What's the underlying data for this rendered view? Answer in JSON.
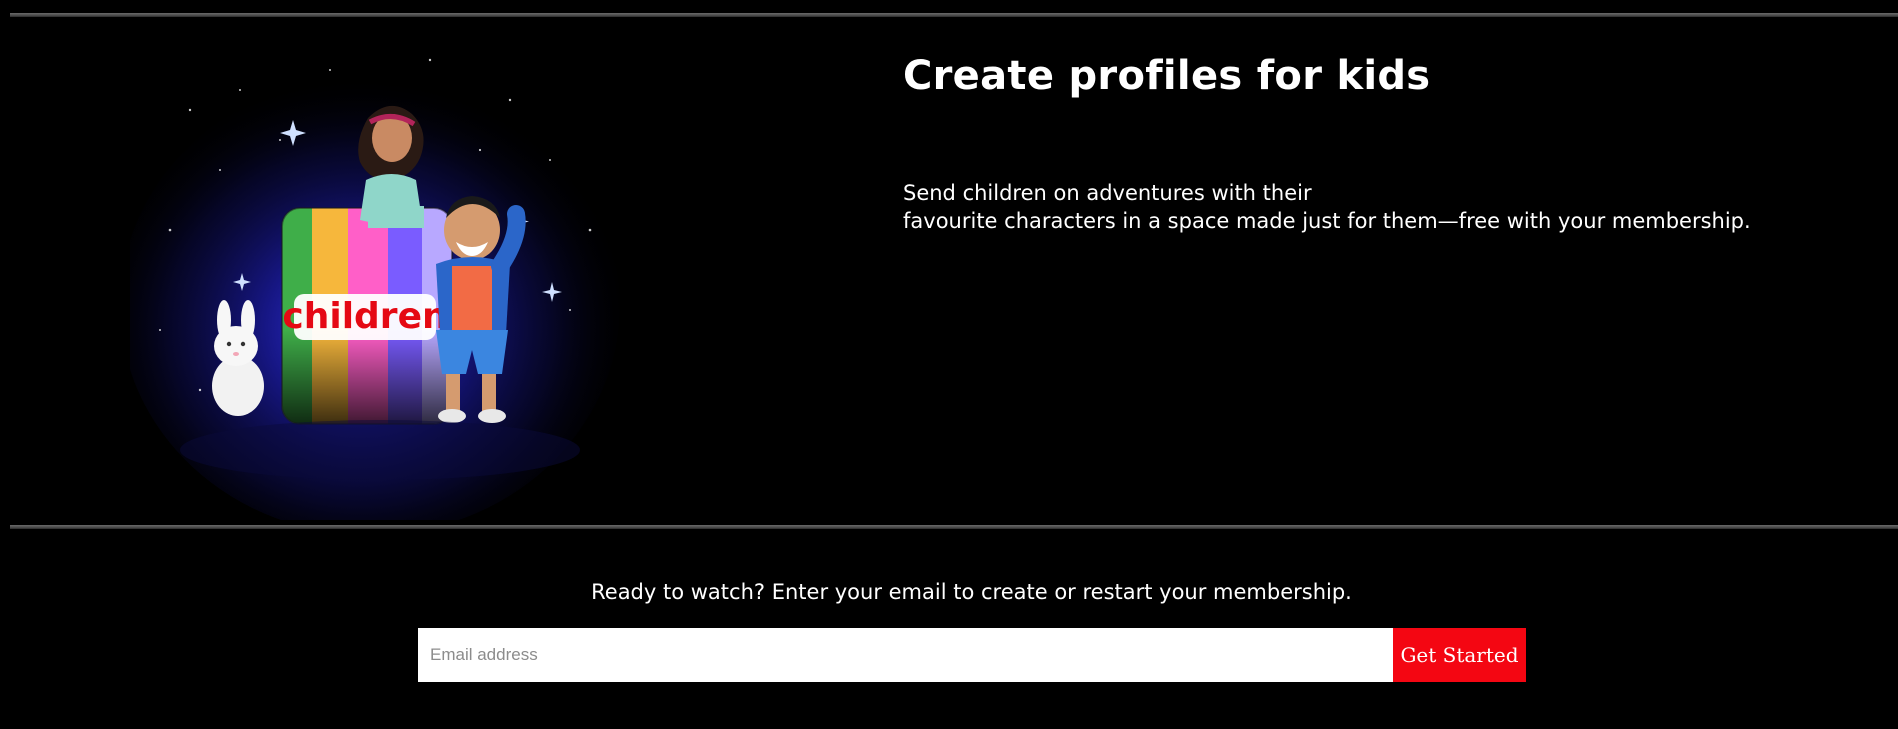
{
  "feature": {
    "title": "Create profiles for kids",
    "description_line1": "Send children on adventures with their",
    "description_line2": "favourite characters in a space made just for them—free with your membership.",
    "image_label": "children",
    "image_subject": "kids-profile-illustration"
  },
  "signup": {
    "prompt": "Ready to watch? Enter your email to create or restart your membership.",
    "email_placeholder": "Email address",
    "button_label": "Get Started"
  },
  "colors": {
    "background": "#000000",
    "text": "#ffffff",
    "button": "#f40612",
    "divider": "#4a4a4a"
  }
}
